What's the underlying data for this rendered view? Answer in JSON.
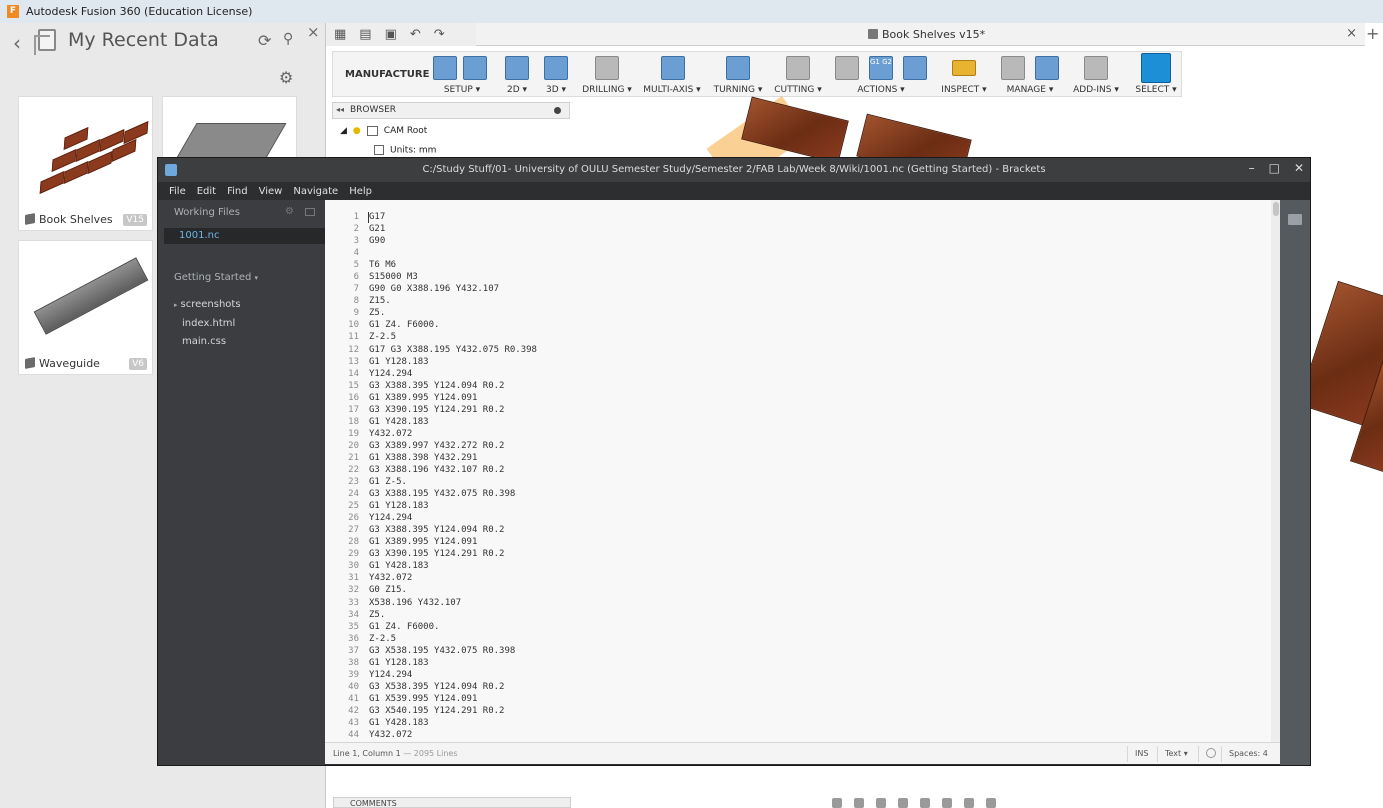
{
  "fusion": {
    "logo": "F",
    "title": "Autodesk Fusion 360 (Education License)",
    "document_tab": "Book Shelves v15*"
  },
  "data_panel": {
    "title": "My Recent Data",
    "designs": [
      {
        "name": "Book Shelves",
        "version": "V15"
      },
      {
        "name": "Waveguide",
        "version": "V6"
      }
    ]
  },
  "toolbar": {
    "workspace": "MANUFACTURE",
    "groups": [
      "SETUP",
      "2D",
      "3D",
      "DRILLING",
      "MULTI-AXIS",
      "TURNING",
      "CUTTING",
      "ACTIONS",
      "INSPECT",
      "MANAGE",
      "ADD-INS",
      "SELECT"
    ],
    "actions_icon_text": "G1 G2"
  },
  "browser": {
    "label": "BROWSER",
    "root": "CAM Root",
    "units": "Units: mm"
  },
  "comments": {
    "label": "COMMENTS"
  },
  "brackets": {
    "title": "C:/Study Stuff/01- University of OULU Semester Study/Semester 2/FAB Lab/Week 8/Wiki/1001.nc (Getting Started) - Brackets",
    "menu": [
      "File",
      "Edit",
      "Find",
      "View",
      "Navigate",
      "Help"
    ],
    "working_files_label": "Working Files",
    "working_files": [
      "1001.nc"
    ],
    "project_label": "Getting Started",
    "project_tree": [
      "screenshots",
      "index.html",
      "main.css"
    ],
    "code_lines": [
      "G17",
      "G21",
      "G90",
      "",
      "T6 M6",
      "S15000 M3",
      "G90 G0 X388.196 Y432.107",
      "Z15.",
      "Z5.",
      "G1 Z4. F6000.",
      "Z-2.5",
      "G17 G3 X388.195 Y432.075 R0.398",
      "G1 Y128.183",
      "Y124.294",
      "G3 X388.395 Y124.094 R0.2",
      "G1 X389.995 Y124.091",
      "G3 X390.195 Y124.291 R0.2",
      "G1 Y428.183",
      "Y432.072",
      "G3 X389.997 Y432.272 R0.2",
      "G1 X388.398 Y432.291",
      "G3 X388.196 Y432.107 R0.2",
      "G1 Z-5.",
      "G3 X388.195 Y432.075 R0.398",
      "G1 Y128.183",
      "Y124.294",
      "G3 X388.395 Y124.094 R0.2",
      "G1 X389.995 Y124.091",
      "G3 X390.195 Y124.291 R0.2",
      "G1 Y428.183",
      "Y432.072",
      "G0 Z15.",
      "X538.196 Y432.107",
      "Z5.",
      "G1 Z4. F6000.",
      "Z-2.5",
      "G3 X538.195 Y432.075 R0.398",
      "G1 Y128.183",
      "Y124.294",
      "G3 X538.395 Y124.094 R0.2",
      "G1 X539.995 Y124.091",
      "G3 X540.195 Y124.291 R0.2",
      "G1 Y428.183",
      "Y432.072"
    ],
    "status": {
      "position": "Line 1, Column 1",
      "lines": "2095 Lines",
      "mode": "INS",
      "language": "Text",
      "spaces": "Spaces: 4"
    }
  }
}
